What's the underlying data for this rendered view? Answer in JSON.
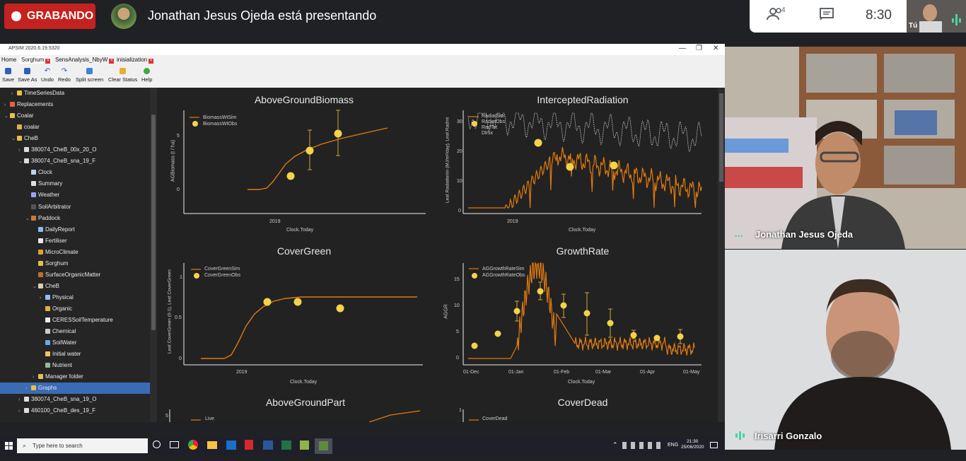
{
  "meet": {
    "recording_label": "GRABANDO",
    "presenting_text": "Jonathan Jesus Ojeda está presentando",
    "participants_count": "4",
    "time": "8:30",
    "self_label": "Tú"
  },
  "apsim": {
    "window_title": "APSIM 2020.6.19.5320",
    "tabs": [
      {
        "label": "Home"
      },
      {
        "label": "Sorghum"
      },
      {
        "label": "SensAnalysis_NbyW"
      },
      {
        "label": "inisialization"
      }
    ],
    "toolbar": {
      "save": "Save",
      "save_as": "Save As",
      "undo": "Undo",
      "redo": "Redo",
      "split": "Split screen",
      "clear": "Clear Status",
      "help": "Help"
    },
    "tree": [
      {
        "label": "TimeSeriesData",
        "depth": 1,
        "arrow": "›",
        "color": "#f0c040"
      },
      {
        "label": "Replacements",
        "depth": 0,
        "arrow": "›",
        "color": "#e8623a"
      },
      {
        "label": "Coalar",
        "depth": 0,
        "arrow": "⌄",
        "color": "#e8c04a"
      },
      {
        "label": "coalar",
        "depth": 1,
        "arrow": "",
        "color": "#e0b050"
      },
      {
        "label": "CheB",
        "depth": 1,
        "arrow": "⌄",
        "color": "#e8c04a"
      },
      {
        "label": "380074_CheB_00x_20_O",
        "depth": 2,
        "arrow": "›",
        "color": "#dddddd"
      },
      {
        "label": "380074_CheB_sna_19_F",
        "depth": 2,
        "arrow": "⌄",
        "color": "#dddddd"
      },
      {
        "label": "Clock",
        "depth": 3,
        "arrow": "",
        "color": "#bcd2f0"
      },
      {
        "label": "Summary",
        "depth": 3,
        "arrow": "",
        "color": "#dddddd"
      },
      {
        "label": "Weather",
        "depth": 3,
        "arrow": "",
        "color": "#a0a0ff"
      },
      {
        "label": "SoilArbitrator",
        "depth": 3,
        "arrow": "",
        "color": "#555555"
      },
      {
        "label": "Paddock",
        "depth": 3,
        "arrow": "⌄",
        "color": "#c87a3a"
      },
      {
        "label": "DailyReport",
        "depth": 4,
        "arrow": "",
        "color": "#8fbbe8"
      },
      {
        "label": "Fertiliser",
        "depth": 4,
        "arrow": "",
        "color": "#e8e8e8"
      },
      {
        "label": "MicroClimate",
        "depth": 4,
        "arrow": "",
        "color": "#e0a030"
      },
      {
        "label": "Sorghum",
        "depth": 4,
        "arrow": "",
        "color": "#e8c040"
      },
      {
        "label": "SurfaceOrganicMatter",
        "depth": 4,
        "arrow": "",
        "color": "#c0702a"
      },
      {
        "label": "CheB",
        "depth": 4,
        "arrow": "⌄",
        "color": "#d8d0b0"
      },
      {
        "label": "Physical",
        "depth": 5,
        "arrow": "›",
        "color": "#90c0f0"
      },
      {
        "label": "Organic",
        "depth": 5,
        "arrow": "",
        "color": "#e0b040"
      },
      {
        "label": "CERESSoilTemperature",
        "depth": 5,
        "arrow": "",
        "color": "#eeeeee"
      },
      {
        "label": "Chemical",
        "depth": 5,
        "arrow": "",
        "color": "#cccccc"
      },
      {
        "label": "SoilWater",
        "depth": 5,
        "arrow": "",
        "color": "#6aa8e8"
      },
      {
        "label": "Initial water",
        "depth": 5,
        "arrow": "",
        "color": "#e8c860"
      },
      {
        "label": "Nutrient",
        "depth": 5,
        "arrow": "",
        "color": "#9ab89a"
      },
      {
        "label": "Manager folder",
        "depth": 4,
        "arrow": "›",
        "color": "#e8c04a"
      },
      {
        "label": "Graphs",
        "depth": 3,
        "arrow": "›",
        "color": "#e8c04a"
      },
      {
        "label": "380074_CheB_sna_19_O",
        "depth": 2,
        "arrow": "›",
        "color": "#dddddd"
      },
      {
        "label": "460100_CheB_des_19_F",
        "depth": 2,
        "arrow": "›",
        "color": "#dddddd"
      }
    ]
  },
  "plots": {
    "agb": {
      "title": "AboveGroundBiomass",
      "legend_sim": "BiomassWtSim",
      "legend_obs": "BiomassWtObs",
      "ylabel": "AGBiomass (t / ha)",
      "xlabel": "Clock.Today",
      "xtick": "2019",
      "yticks": [
        "5",
        "0"
      ]
    },
    "ir": {
      "title": "InterceptedRadiation",
      "legend_sim": "RadiatSim",
      "legend_obs": "RadiatObs",
      "legend_3": "RadTot",
      "legend_4": "Dlrsx",
      "ylabel": "Leaf.RadiationIn (MJ/m²/day), Leaf.RadInt",
      "xlabel": "Clock.Today",
      "xtick": "2019",
      "yticks": [
        "30",
        "20",
        "10",
        "0"
      ]
    },
    "cg": {
      "title": "CoverGreen",
      "legend_sim": "CoverGreenSim",
      "legend_obs": "CoverGreenObs",
      "ylabel": "Leaf.CoverGreen (0-1), Leaf.CoverGreen",
      "xlabel": "Clock.Today",
      "xtick": "2019",
      "yticks": [
        "1",
        "0.5",
        "0"
      ]
    },
    "gr": {
      "title": "GrowthRate",
      "legend_sim": "AGGrowthRateSim",
      "legend_obs": "AGGrowthRateObs",
      "ylabel": "AGGR",
      "xlabel": "Clock.Today",
      "xticks": [
        "01-Dec",
        "01-Jan",
        "01-Feb",
        "01-Mar",
        "01-Apr",
        "01-May"
      ],
      "yticks": [
        "15",
        "10",
        "5",
        "0"
      ]
    },
    "agp": {
      "title": "AboveGroundPart",
      "legend": "Live",
      "ytick": "5"
    },
    "cd": {
      "title": "CoverDead",
      "legend": "CoverDead",
      "ytick": "1"
    }
  },
  "participants": [
    {
      "name": "Jonathan Jesus Ojeda"
    },
    {
      "name": "Irisarri Gonzalo"
    }
  ],
  "taskbar": {
    "search_placeholder": "Type here to search",
    "lang": "ENG",
    "time": "21:30",
    "date": "25/06/2020"
  },
  "colors": {
    "recording": "#c5221f",
    "sim_line": "#e07a10",
    "obs_point": "#f3d34a",
    "selection": "#3a6bb5"
  }
}
